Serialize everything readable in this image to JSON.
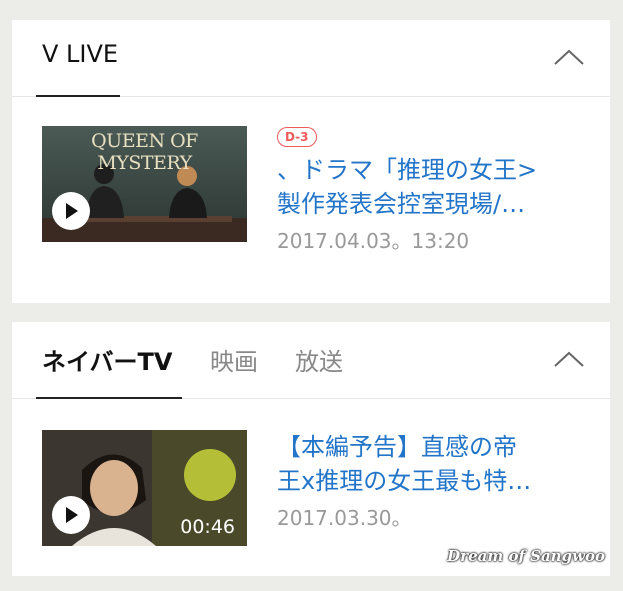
{
  "vlive": {
    "header_label": "V LIVE",
    "item": {
      "badge": "D-3",
      "title_line1": "、ドラマ「推理の女王>",
      "title_line2": "製作発表会控室現場/…",
      "date": "2017.04.03。13:20",
      "thumbnail_title": "QUEEN OF MYSTERY"
    }
  },
  "naver": {
    "tabs": [
      {
        "label": "ネイバーTV",
        "active": true
      },
      {
        "label": "映画",
        "active": false
      },
      {
        "label": "放送",
        "active": false
      }
    ],
    "item": {
      "title_line1": "【本編予告】直感の帝",
      "title_line2": "王x推理の女王最も特…",
      "date": "2017.03.30。",
      "duration": "00:46"
    }
  },
  "watermark": "Dream of Sangwoo",
  "colors": {
    "link": "#2275c9",
    "badge": "#f05a5a",
    "date": "#999999"
  }
}
